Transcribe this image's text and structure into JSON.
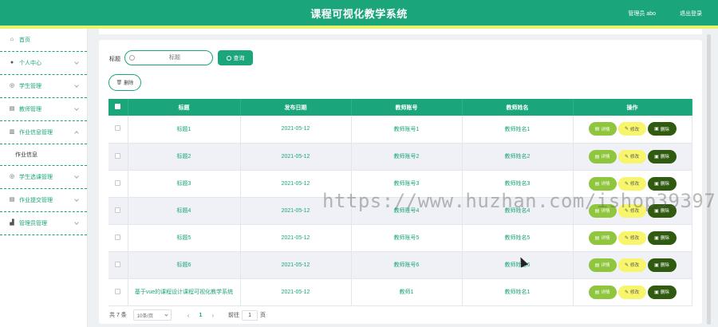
{
  "header": {
    "title": "课程可视化教学系统",
    "user": "管理员 abo",
    "logout": "退出登录"
  },
  "sidebar": {
    "items": [
      {
        "label": "首页",
        "icon": "home-icon",
        "glyph": "⌂"
      },
      {
        "label": "个人中心",
        "icon": "user-icon",
        "glyph": "●"
      },
      {
        "label": "学生管理",
        "icon": "compass-icon",
        "glyph": "◎"
      },
      {
        "label": "教师管理",
        "icon": "document-icon",
        "glyph": "▤"
      },
      {
        "label": "作业信息管理",
        "icon": "bank-icon",
        "glyph": "▥"
      },
      {
        "label": "作业信息",
        "sub": true
      },
      {
        "label": "学生选课管理",
        "icon": "compass-icon",
        "glyph": "◎"
      },
      {
        "label": "作业提交管理",
        "icon": "document-icon",
        "glyph": "▤"
      },
      {
        "label": "管理员管理",
        "icon": "chart-icon",
        "glyph": "▟"
      }
    ]
  },
  "search": {
    "label": "标题",
    "placeholder": "标题",
    "button": "查询"
  },
  "toolbar": {
    "delete": "删除"
  },
  "table": {
    "columns": [
      "标题",
      "发布日期",
      "教师账号",
      "教师姓名",
      "操作"
    ],
    "rows": [
      {
        "title": "标题1",
        "date": "2021-05-12",
        "account": "教师账号1",
        "name": "教师姓名1"
      },
      {
        "title": "标题2",
        "date": "2021-05-12",
        "account": "教师账号2",
        "name": "教师姓名2"
      },
      {
        "title": "标题3",
        "date": "2021-05-12",
        "account": "教师账号3",
        "name": "教师姓名3"
      },
      {
        "title": "标题4",
        "date": "2021-05-12",
        "account": "教师账号4",
        "name": "教师姓名4"
      },
      {
        "title": "标题5",
        "date": "2021-05-12",
        "account": "教师账号5",
        "name": "教师姓名5"
      },
      {
        "title": "标题6",
        "date": "2021-05-12",
        "account": "教师账号6",
        "name": "教师姓名6"
      },
      {
        "title": "基于vue的课程设计课程可视化教学系统",
        "date": "2021-05-12",
        "account": "教师1",
        "name": "教师姓名1"
      }
    ],
    "actions": {
      "detail": "详情",
      "edit": "修改",
      "delete": "删除"
    }
  },
  "pagination": {
    "total": "共 7 条",
    "page_size": "10条/页",
    "current_page": "1",
    "goto_label": "前往",
    "goto_value": "1",
    "page_unit": "页"
  },
  "watermark": "https://www.huzhan.com/ishop39397",
  "colors": {
    "primary": "#1aa57a",
    "accent_line": "#e8f26a",
    "detail_btn": "#8fc63d",
    "edit_btn": "#f7f56b",
    "delete_btn": "#2f5a10"
  }
}
